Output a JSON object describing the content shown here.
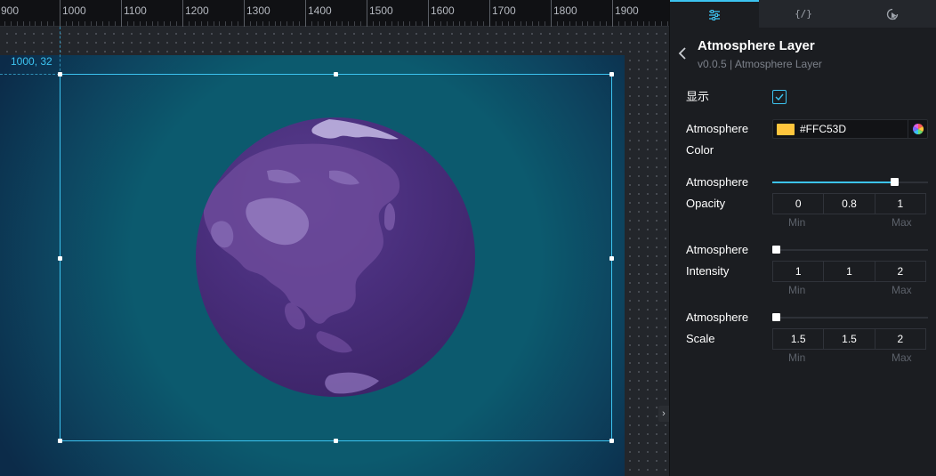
{
  "ruler": {
    "labels": [
      "900",
      "1000",
      "1100",
      "1200",
      "1300",
      "1400",
      "1500",
      "1600",
      "1700",
      "1800",
      "1900"
    ]
  },
  "canvas": {
    "position_readout": "1000, 32",
    "toggle_glyph": "›"
  },
  "tabs": [
    {
      "label": "",
      "icon": "sliders-icon",
      "active": true
    },
    {
      "label": "{/}",
      "icon": "code-icon",
      "active": false
    },
    {
      "label": "",
      "icon": "interaction-icon",
      "active": false
    }
  ],
  "panel": {
    "title": "Atmosphere Layer",
    "subtitle": "v0.0.5 | Atmosphere Layer",
    "show": {
      "label": "显示",
      "checked": true
    },
    "atmosphere_color": {
      "label_line1": "Atmosphere",
      "label_line2": "Color",
      "value": "#FFC53D",
      "swatch": "#ffc53d"
    },
    "atmosphere_opacity": {
      "label_line1": "Atmosphere",
      "label_line2": "Opacity",
      "min": "0",
      "value": "0.8",
      "max": "1",
      "min_caption": "Min",
      "max_caption": "Max",
      "fraction": 0.8
    },
    "atmosphere_intensity": {
      "label_line1": "Atmosphere",
      "label_line2": "Intensity",
      "min": "1",
      "value": "1",
      "max": "2",
      "min_caption": "Min",
      "max_caption": "Max",
      "fraction": 0
    },
    "atmosphere_scale": {
      "label_line1": "Atmosphere",
      "label_line2": "Scale",
      "min": "1.5",
      "value": "1.5",
      "max": "2",
      "min_caption": "Min",
      "max_caption": "Max",
      "fraction": 0
    }
  },
  "colors": {
    "accent": "#3cc3f0",
    "atmosphere": "#FFC53D"
  }
}
